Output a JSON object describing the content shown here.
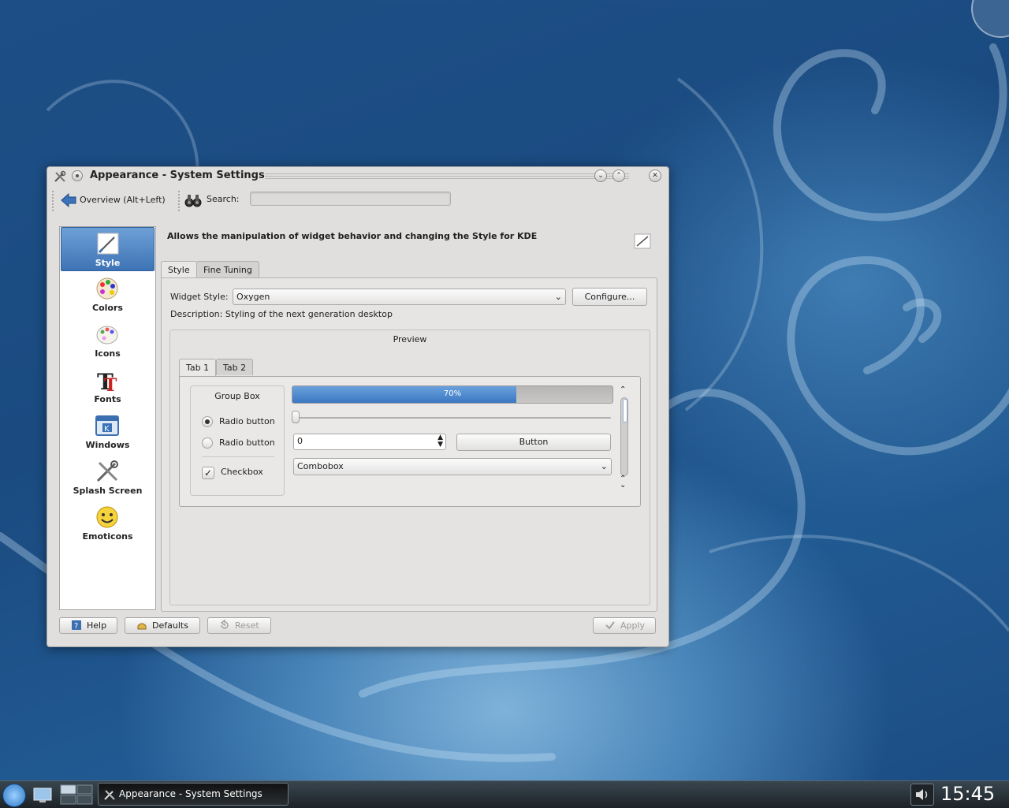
{
  "window": {
    "title": "Appearance - System Settings",
    "toolbar": {
      "back_label": "Overview (Alt+Left)",
      "search_label": "Search:",
      "search_value": ""
    }
  },
  "sidebar": {
    "items": [
      {
        "label": "Style",
        "icon": "style-brush-icon",
        "selected": true
      },
      {
        "label": "Colors",
        "icon": "colors-palette-icon",
        "selected": false
      },
      {
        "label": "Icons",
        "icon": "icons-palette-icon",
        "selected": false
      },
      {
        "label": "Fonts",
        "icon": "fonts-icon",
        "selected": false
      },
      {
        "label": "Windows",
        "icon": "windows-icon",
        "selected": false
      },
      {
        "label": "Splash Screen",
        "icon": "splash-tools-icon",
        "selected": false
      },
      {
        "label": "Emoticons",
        "icon": "emoticons-smiley-icon",
        "selected": false
      }
    ]
  },
  "content": {
    "heading": "Allows the manipulation of widget behavior and changing the Style for KDE",
    "tabs": [
      {
        "label": "Style",
        "active": true
      },
      {
        "label": "Fine Tuning",
        "active": false
      }
    ],
    "widget_style_label": "Widget Style:",
    "widget_style_value": "Oxygen",
    "configure_label": "Configure...",
    "description": "Description: Styling of the next generation desktop",
    "preview": {
      "title": "Preview",
      "tabs": [
        {
          "label": "Tab 1",
          "active": true
        },
        {
          "label": "Tab 2",
          "active": false
        }
      ],
      "group_box_title": "Group Box",
      "radio1": "Radio button",
      "radio2": "Radio button",
      "checkbox": "Checkbox",
      "checkbox_checked": true,
      "progress_value": 0.7,
      "progress_text": "70%",
      "slider_value": 0,
      "spin_value": "0",
      "button_label": "Button",
      "combobox_value": "Combobox"
    }
  },
  "footer": {
    "help": "Help",
    "defaults": "Defaults",
    "reset": "Reset",
    "apply": "Apply"
  },
  "taskbar": {
    "task_title": "Appearance - System Settings",
    "clock": "15:45"
  },
  "colors": {
    "selection": "#3e74b5",
    "progress": "#3b78c2",
    "desktop": "#1d4f86"
  }
}
